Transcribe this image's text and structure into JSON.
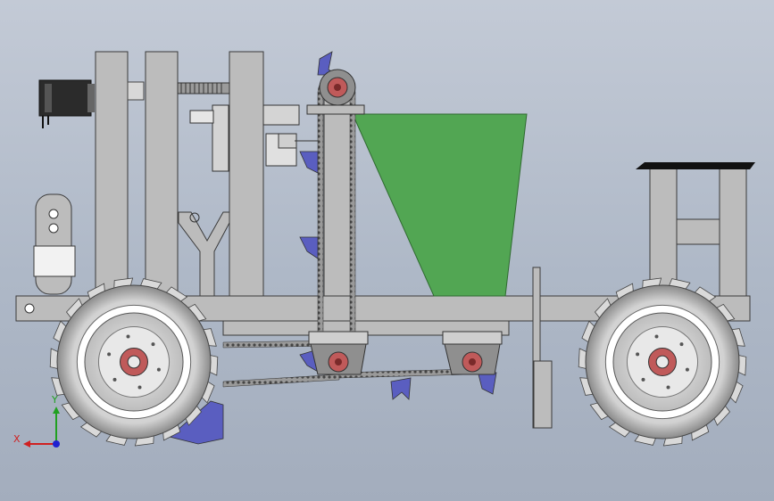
{
  "viewport": {
    "background_top": "#c3cad6",
    "background_bottom": "#a3adbd"
  },
  "colors": {
    "frame": "#bcbcbc",
    "frame_stroke": "#3a3a3a",
    "hopper": "#52a653",
    "hub": "#c05a5a",
    "furrow_opener": "#5a5ec0",
    "tire": "#cfcfcf",
    "chain": "#555555",
    "motor": "#2b2b2b"
  },
  "model": {
    "components": [
      "frame",
      "stepper-motor",
      "lead-screw",
      "seed-hopper",
      "chain-drive",
      "sprockets",
      "furrow-openers",
      "front-wheel",
      "rear-wheel",
      "seat"
    ]
  },
  "triad": {
    "x_label": "X",
    "y_label": "Y",
    "x_color": "#d02020",
    "y_color": "#20a020",
    "z_color": "#2020d0"
  }
}
